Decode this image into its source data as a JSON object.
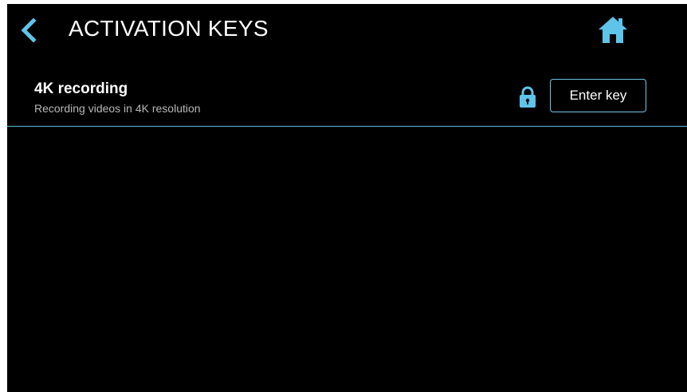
{
  "header": {
    "title": "ACTIVATION KEYS",
    "back_icon": "chevron-left-icon",
    "home_icon": "home-icon"
  },
  "features": [
    {
      "name": "4K recording",
      "description": "Recording videos in 4K resolution",
      "status_icon": "lock-icon",
      "action_label": "Enter key"
    }
  ],
  "colors": {
    "background": "#000000",
    "accent": "#5fc4ea",
    "divider": "#5fb8d6",
    "text_primary": "#ffffff",
    "text_secondary": "#b8b8b8"
  }
}
